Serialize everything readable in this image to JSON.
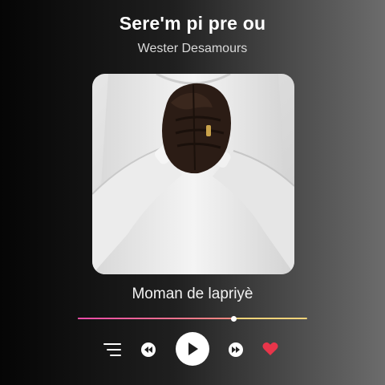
{
  "track": {
    "title": "Sere'm pi pre ou",
    "artist": "Wester Desamours",
    "album": "Moman de lapriyè"
  },
  "playback": {
    "progress_fraction": 0.68,
    "liked": true
  },
  "controls": {
    "queue_icon": "queue-list-icon",
    "prev_icon": "rewind-icon",
    "play_icon": "play-icon",
    "next_icon": "fast-forward-icon",
    "like_icon": "heart-icon"
  },
  "colors": {
    "progress_start": "#e94aa8",
    "progress_end": "#f08a7e",
    "progress_track": "#f3d37a",
    "heart": "#e8354a",
    "button_bg": "#ffffff",
    "icon_dark": "#222222"
  }
}
